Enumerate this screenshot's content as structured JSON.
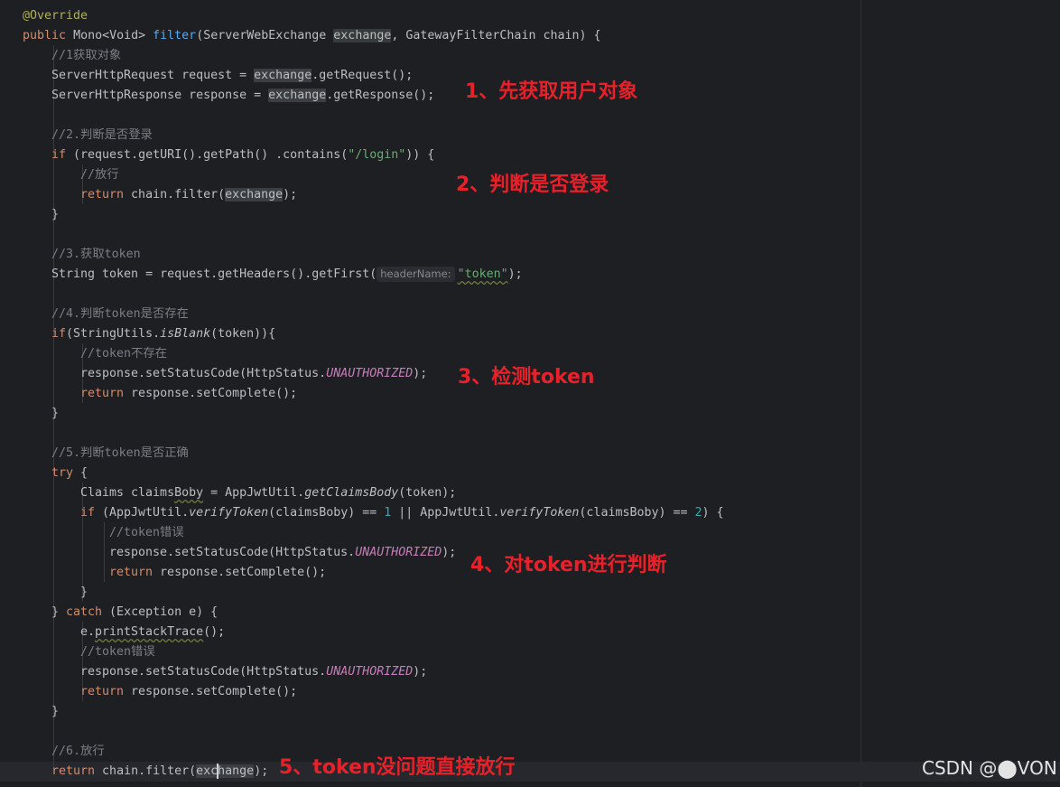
{
  "code": {
    "override_annotation": "@Override",
    "signature": {
      "kw_public": "public",
      "return_type": "Mono<Void>",
      "method_name": "filter",
      "paren_open": "(ServerWebExchange ",
      "param_exchange": "exchange",
      "param_rest": ", GatewayFilterChain chain) {"
    },
    "l_comment1": "//1获取对象",
    "l_request_a": "ServerHttpRequest request = ",
    "l_request_b": "exchange",
    "l_request_c": ".getRequest();",
    "l_response_a": "ServerHttpResponse response = ",
    "l_response_b": "exchange",
    "l_response_c": ".getResponse();",
    "l_comment2": "//2.判断是否登录",
    "l_if_kw": "if",
    "l_if_a": " (request.getURI().getPath() .contains(",
    "l_if_str": "\"/login\"",
    "l_if_c": ")) {",
    "l_comment_pass": "//放行",
    "l_return_kw": "return",
    "l_ret_a": " chain.filter(",
    "l_ret_b": "exchange",
    "l_ret_c": ");",
    "close_brace": "}",
    "l_comment3": "//3.获取token",
    "l_token_a": "String token = request.getHeaders().getFirst(",
    "l_token_hint": "headerName:",
    "l_token_str": "\"token\"",
    "l_token_c": ");",
    "l_comment4": "//4.判断token是否存在",
    "l_if2_kw": "if",
    "l_if2_a": "(StringUtils.",
    "l_if2_b": "isBlank",
    "l_if2_c": "(token)){",
    "l_comment_notexist": "//token不存在",
    "l_status_a": "response.setStatusCode(HttpStatus.",
    "l_status_const": "UNAUTHORIZED",
    "l_status_c": ");",
    "l_complete_a": " response.setComplete();",
    "l_comment5": "//5.判断token是否正确",
    "l_try_kw": "try",
    "l_try_b": " {",
    "l_claims_a": "Claims claims",
    "l_claims_b": "Boby",
    "l_claims_c": " = AppJwtUtil.",
    "l_claims_d": "getClaimsBody",
    "l_claims_e": "(token);",
    "l_if3_kw": "if",
    "l_if3_a": " (AppJwtUtil.",
    "l_if3_b": "verifyToken",
    "l_if3_c": "(claimsBoby) == ",
    "l_if3_n1": "1",
    "l_if3_d": " || AppJwtUtil.",
    "l_if3_e": "verifyToken",
    "l_if3_f": "(claimsBoby) == ",
    "l_if3_n2": "2",
    "l_if3_g": ") {",
    "l_comment_err": "//token错误",
    "l_catch_a": "} ",
    "l_catch_kw": "catch",
    "l_catch_b": " (Exception e) {",
    "l_print_a": "e.",
    "l_print_b": "printStackTrace",
    "l_print_c": "();",
    "l_comment6": "//6.放行",
    "l_final_a": " chain.filter(",
    "l_final_b1": "exc",
    "l_final_b2": "hange",
    "l_final_c": ");"
  },
  "annotations": {
    "step1": "1、先获取用户对象",
    "step2": "2、判断是否登录",
    "step3": "3、检测token",
    "step4": "4、对token进行判断",
    "step5": "5、token没问题直接放行"
  },
  "watermark": "CSDN @⬤VON",
  "colors": {
    "background": "#1e1f22",
    "keyword": "#cf8e6d",
    "annotation": "#b3ae60",
    "function": "#56a8f5",
    "comment": "#7a7e85",
    "string": "#6aab73",
    "number": "#2aacb8",
    "constant": "#c77dbb",
    "note_red": "#e8202a"
  }
}
